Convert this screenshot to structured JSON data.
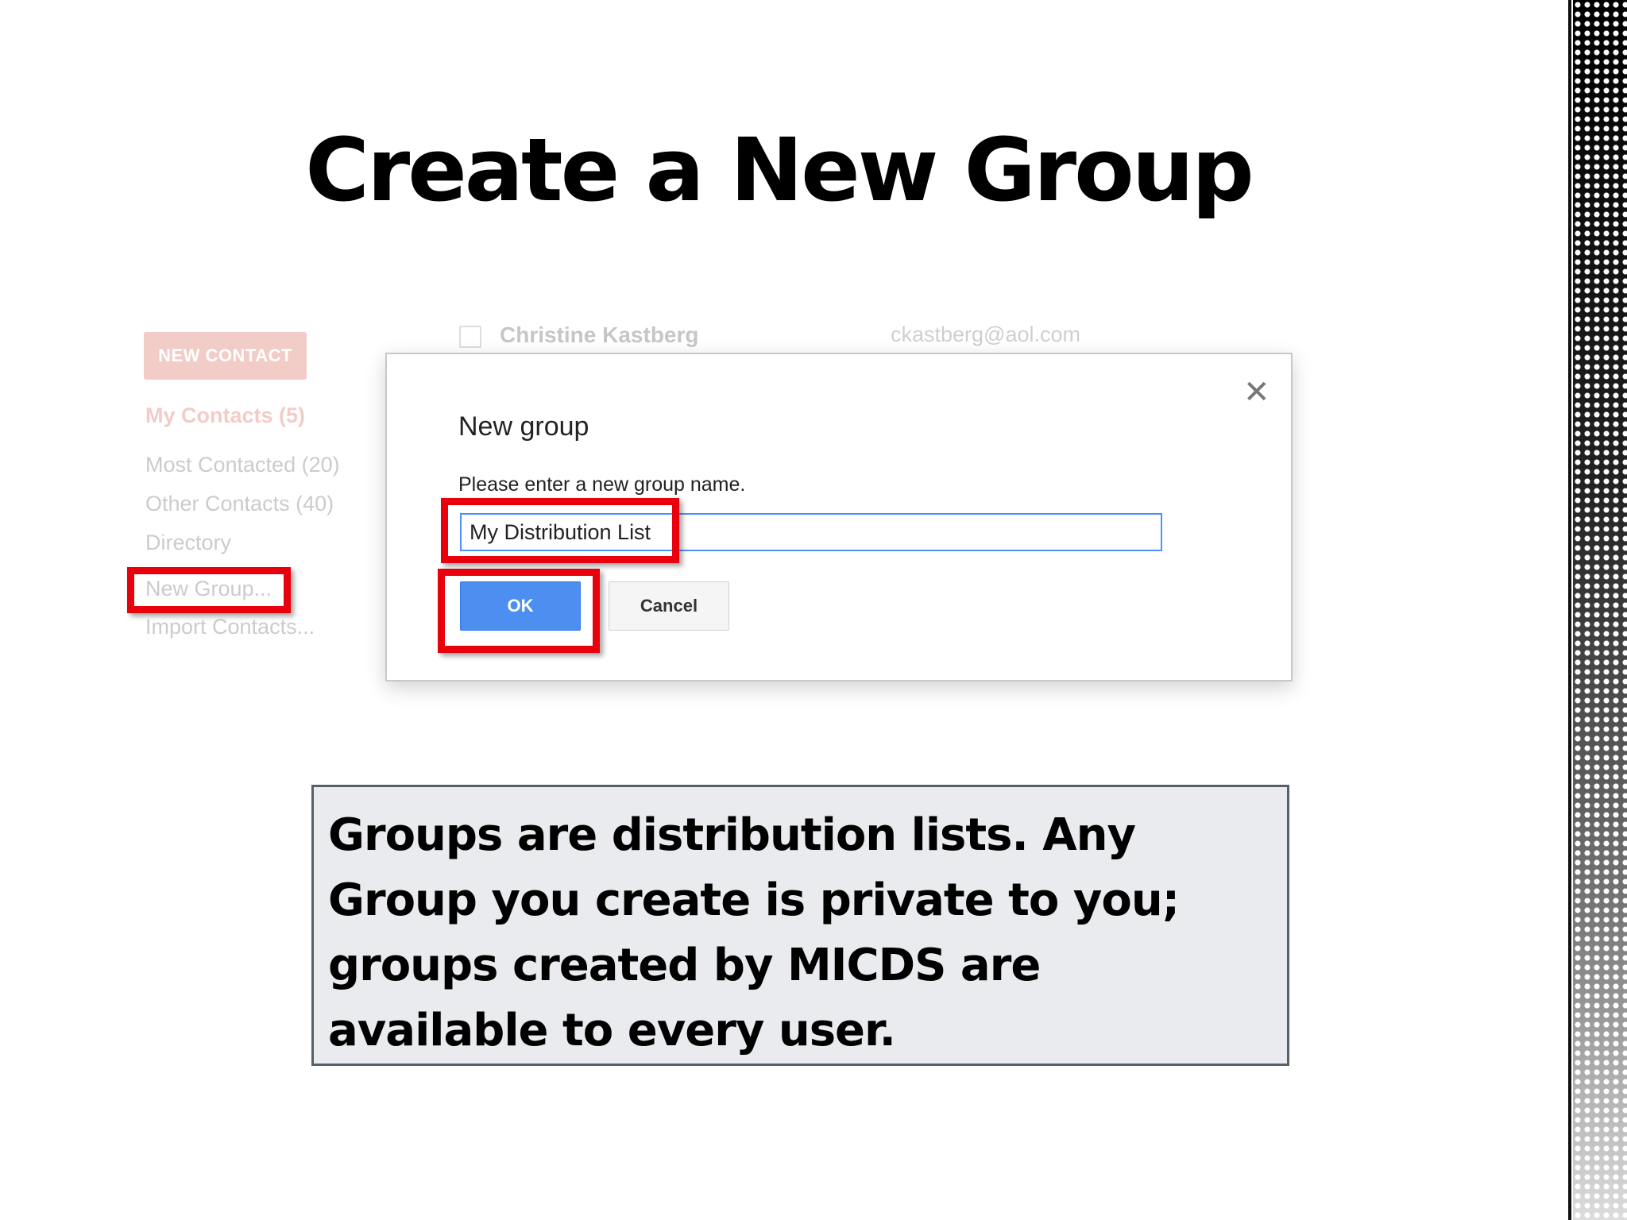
{
  "slide": {
    "title": "Create a New Group",
    "note": "Groups are distribution lists.  Any Group you create is private to you; groups created by MICDS are available to every user."
  },
  "sidebar": {
    "new_contact_label": "NEW CONTACT",
    "items": [
      {
        "label": "My Contacts (5)"
      },
      {
        "label": "Most Contacted (20)"
      },
      {
        "label": "Other Contacts (40)"
      },
      {
        "label": "Directory"
      },
      {
        "label": "New Group..."
      },
      {
        "label": "Import Contacts..."
      }
    ]
  },
  "contact_row": {
    "name": "Christine Kastberg",
    "email": "ckastberg@aol.com"
  },
  "dialog": {
    "title": "New group",
    "prompt": "Please enter a new group name.",
    "input_value": "My Distribution List",
    "ok_label": "OK",
    "cancel_label": "Cancel",
    "close_icon": "close-icon"
  },
  "colors": {
    "highlight": "#e8000d",
    "ok_button": "#4d8ff1",
    "brand_red": "#d14836"
  }
}
